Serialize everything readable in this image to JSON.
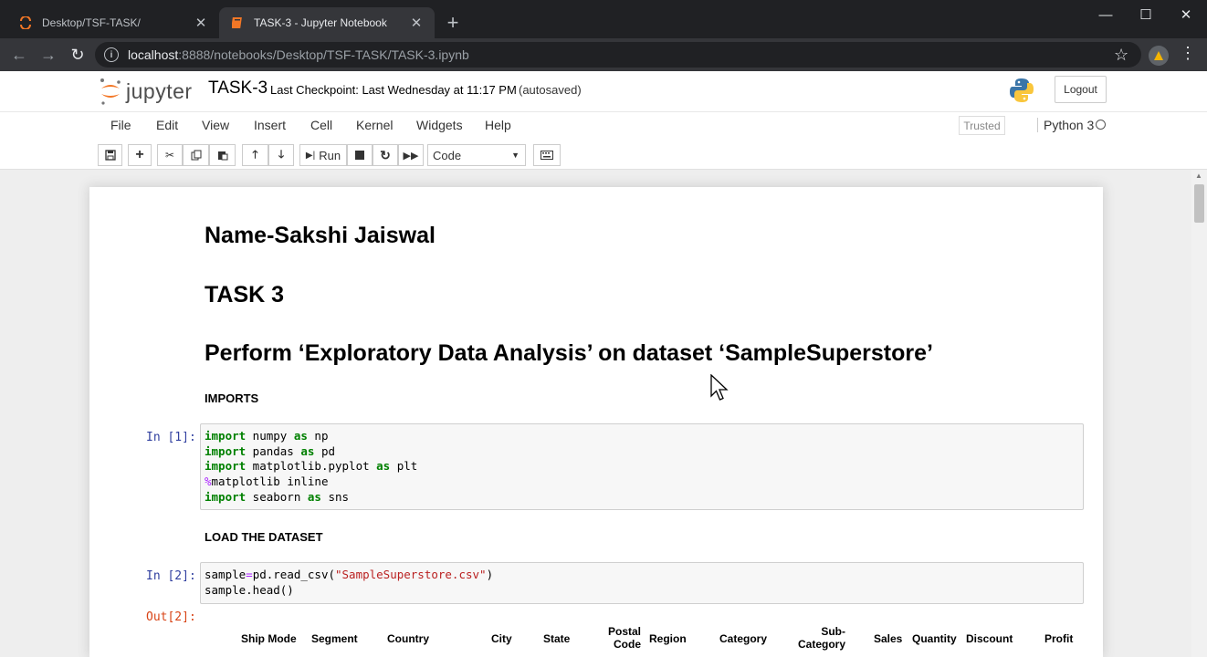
{
  "browser": {
    "tabs": [
      {
        "title": "Desktop/TSF-TASK/",
        "active": false
      },
      {
        "title": "TASK-3 - Jupyter Notebook",
        "active": true
      }
    ],
    "url_host": "localhost",
    "url_rest": ":8888/notebooks/Desktop/TSF-TASK/TASK-3.ipynb"
  },
  "header": {
    "logo_text": "jupyter",
    "notebook_name": "TASK-3",
    "checkpoint": "Last Checkpoint: Last Wednesday at 11:17 PM",
    "autosave": "(autosaved)",
    "logout_label": "Logout"
  },
  "menu": {
    "items": [
      "File",
      "Edit",
      "View",
      "Insert",
      "Cell",
      "Kernel",
      "Widgets",
      "Help"
    ],
    "trusted": "Trusted",
    "kernel": "Python 3"
  },
  "toolbar": {
    "run_label": "Run",
    "cell_type": "Code"
  },
  "notebook": {
    "heading_name": "Name-Sakshi Jaiswal",
    "heading_task": "TASK 3",
    "heading_perform": "Perform ‘Exploratory Data Analysis’ on dataset ‘SampleSuperstore’",
    "section_imports": "IMPORTS",
    "prompt_in1": "In [1]:",
    "section_load": "LOAD THE DATASET",
    "prompt_in2": "In [2]:",
    "prompt_out2": "Out[2]:",
    "table_headers": [
      "Ship Mode",
      "Segment",
      "Country",
      "City",
      "State",
      "Postal Code",
      "Region",
      "Category",
      "Sub-Category",
      "Sales",
      "Quantity",
      "Discount",
      "Profit"
    ]
  }
}
